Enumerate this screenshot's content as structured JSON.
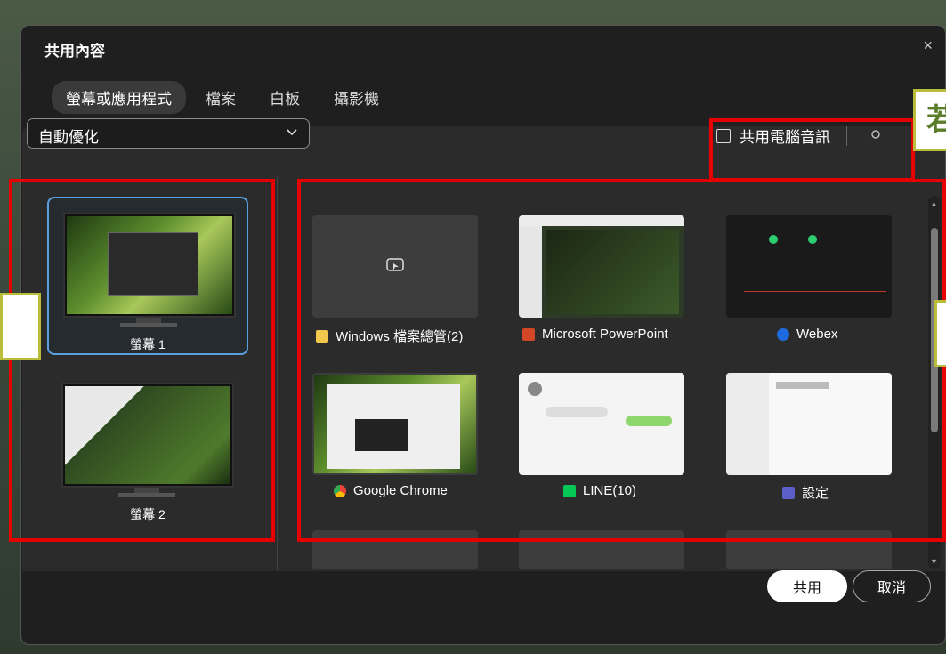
{
  "dialog": {
    "title": "共用內容",
    "close_glyph": "×"
  },
  "tabs": [
    "螢幕或應用程式",
    "檔案",
    "白板",
    "攝影機"
  ],
  "optimize": {
    "value": "自動優化"
  },
  "audio": {
    "label": "共用電腦音訊",
    "checked": false
  },
  "callout_text": "若",
  "screens": [
    {
      "label": "螢幕 1",
      "selected": true
    },
    {
      "label": "螢幕 2",
      "selected": false
    }
  ],
  "apps": [
    {
      "label": "Windows 檔案總管(2)",
      "icon": "folder-icon",
      "color": "#f2c94c"
    },
    {
      "label": "Microsoft PowerPoint",
      "icon": "powerpoint-icon",
      "color": "#d24726"
    },
    {
      "label": "Webex",
      "icon": "webex-icon",
      "color": "#1e6be0"
    },
    {
      "label": "Google Chrome",
      "icon": "chrome-icon",
      "color": "#fbbc05"
    },
    {
      "label": "LINE(10)",
      "icon": "line-icon",
      "color": "#06c755"
    },
    {
      "label": "設定",
      "icon": "settings-icon",
      "color": "#5b5fc7"
    }
  ],
  "buttons": {
    "share": "共用",
    "cancel": "取消"
  },
  "colors": {
    "highlight": "#e60000",
    "callout_border": "#b9bd3a",
    "selected_border": "#5aa0e0"
  }
}
